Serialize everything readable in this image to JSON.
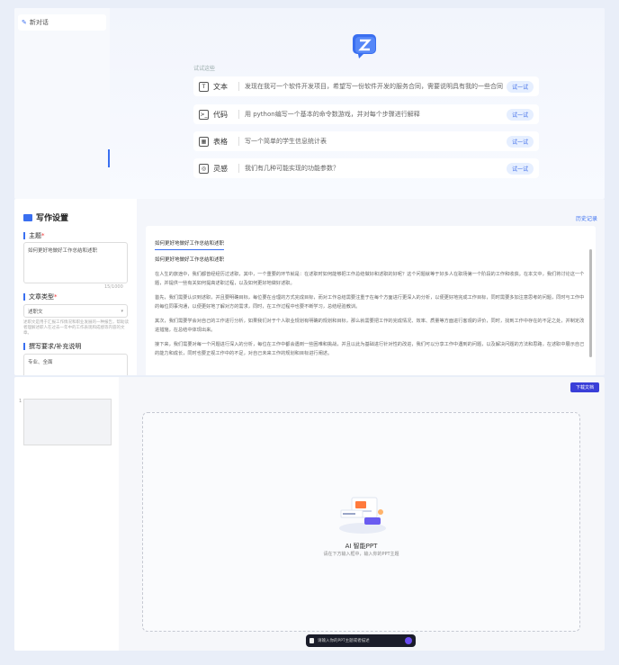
{
  "panel1": {
    "new_chat_label": "新对话",
    "examples_label": "试试这些",
    "examples": [
      {
        "icon": "T",
        "name": "文本",
        "text": "发现在我可一个软件开发项目，希望写一份软件开发的服务合同，需要说明具有我的一些合同",
        "try": "试一试"
      },
      {
        "icon": ">_",
        "name": "代码",
        "text": "用 python编写一个基本的命令数游戏，并对每个步骤进行解释",
        "try": "试一试"
      },
      {
        "icon": "▦",
        "name": "表格",
        "text": "写一个简单的学生信息统计表",
        "try": "试一试"
      },
      {
        "icon": "◎",
        "name": "灵感",
        "text": "我们有几种可能实现的功能参数？",
        "try": "试一试"
      }
    ],
    "logo_icon": "chat-z-logo-icon"
  },
  "panel2": {
    "title": "写作设置",
    "topic_label": "主题",
    "topic_value": "如何更好地做好工作总结和述职",
    "char_count": "15/1000",
    "type_label": "文章类型",
    "type_value": "述职文",
    "type_hint": "述职文是用于汇报工作情况和职业发展的一种报告，帮助读者理解述职人在过去一年中的工作表现和成绩等内容的文章。",
    "extra_label": "撰写要求/补充说明",
    "extra_value": "专业、全面",
    "history_link": "历史记录",
    "doc_tab": "如何更好地做好工作总结和述职",
    "doc_heading": "如何更好地做好工作总结和述职",
    "paragraphs": [
      "在人生的旅途中，我们都曾经经历过述职，其中，一个重要的环节就是：在述职时如何能够把工作总结做好和述职的好呢？这个问题就等于好多人在职场第一个阶段的工作和收获。在本文中，我们将讨论这一个题，并提供一些有关如何提高述职过程，以及如何更好地做好述职。",
      "首先，我们需要认识到述职，并且要明确目标，每位要在合理的方式完成目标，而对工作总结需要注重于在每个方面进行更深入的分析，以便更好地完成工作目标，同时需要多加注意思考的问题，同时与工作中的每位同事沟通，以便更好地了解对方的需求，同时，在工作过程中也要不断学习，总结经验教训。",
      "其次，我们需要学会对自己的工作进行分析，如果我们对于个人职业规划有明确的规划和目标，那么就需要把工作的完成情况、效率、质量等方面进行客观的评价，同时，找到工作中存在的不足之处，并制定改进措施，在总结中体现出来。",
      "接下来，我们需要对每一个问题进行深入的分析，每位在工作中都会遇到一些困难和挑战，并且以此为基础进行针对性的改进，我们可以分享工作中遇到的问题，以及解决问题的方法和思路，在述职中展示自己的能力和成长，同时也要正视工作中的不足，对自己未来工作的规划和目标进行阐述。"
    ]
  },
  "panel3": {
    "thumb_number": "1",
    "export_label": "下载文档",
    "canvas_title": "AI 智能PPT",
    "canvas_sub": "请在下方输入框中，输入你的PPT主题",
    "bottom_placeholder": "请输入你的PPT主题或者描述"
  }
}
